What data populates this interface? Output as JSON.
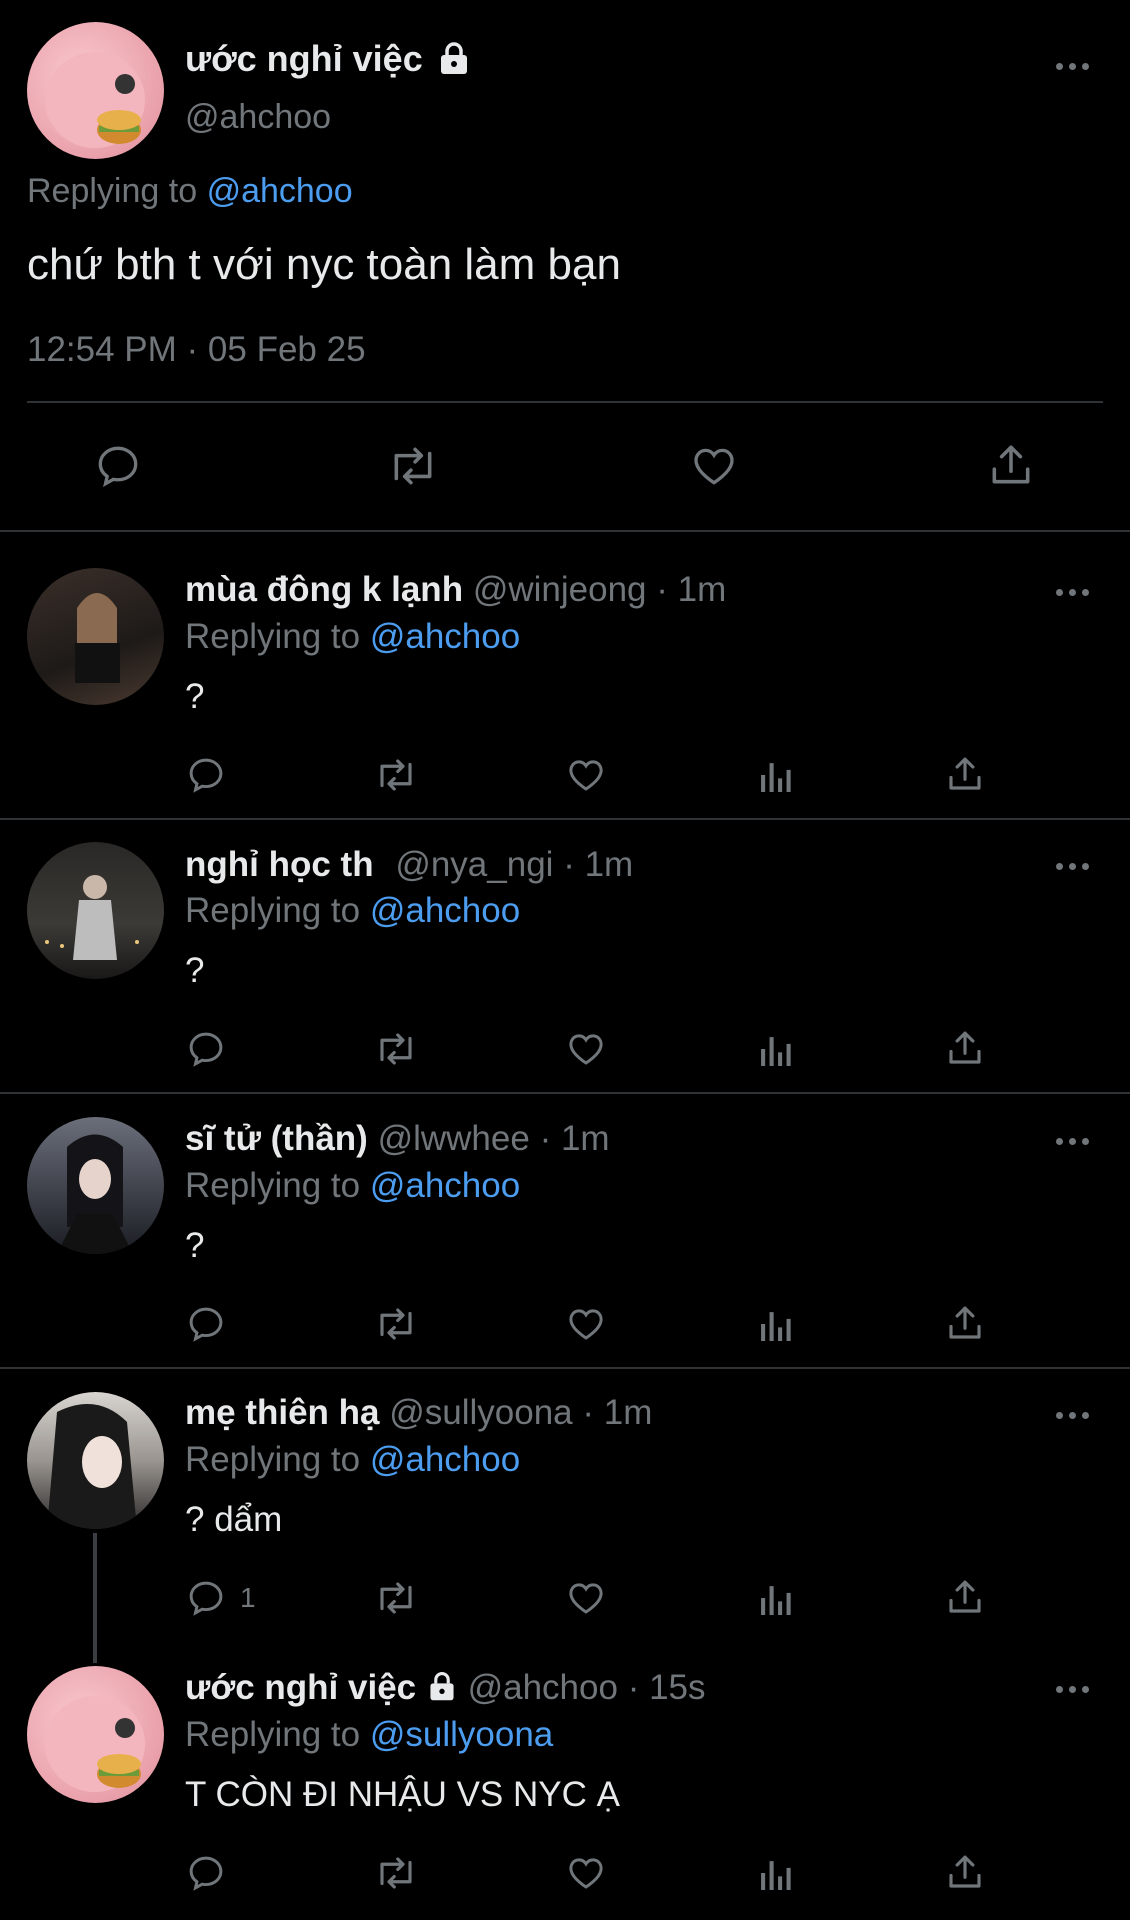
{
  "main_tweet": {
    "display_name": "ước nghỉ việc",
    "handle": "@ahchoo",
    "replying_label": "Replying to",
    "replying_handle": "@ahchoo",
    "text": "chứ bth t với nyc toàn làm bạn",
    "timestamp": "12:54 PM · 05 Feb 25"
  },
  "replies": [
    {
      "display_name": "mùa đông k lạnh",
      "handle": "@winjeong",
      "time": "· 1m",
      "replying_label": "Replying to",
      "replying_handle": "@ahchoo",
      "text": "?",
      "reply_count": ""
    },
    {
      "display_name": "nghỉ học th",
      "handle": "@nya_ngi",
      "time": "· 1m",
      "replying_label": "Replying to",
      "replying_handle": "@ahchoo",
      "text": "?",
      "reply_count": ""
    },
    {
      "display_name": "sĩ tử (thần)",
      "handle": "@lwwhee",
      "time": "· 1m",
      "replying_label": "Replying to",
      "replying_handle": "@ahchoo",
      "text": "?",
      "reply_count": ""
    },
    {
      "display_name": "mẹ thiên hạ",
      "handle": "@sullyoona",
      "time": "· 1m",
      "replying_label": "Replying to",
      "replying_handle": "@ahchoo",
      "text": "? dẩm",
      "reply_count": "1"
    },
    {
      "display_name": "ước nghỉ việc",
      "handle": "@ahchoo",
      "time": "· 15s",
      "replying_label": "Replying to",
      "replying_handle": "@sullyoona",
      "text": "T CÒN ĐI NHẬU VS NYC Ạ",
      "reply_count": ""
    }
  ],
  "colors": {
    "background": "#000000",
    "text": "#e7e9ea",
    "muted": "#71767b",
    "link": "#4c9df0",
    "divider": "#2f3336"
  },
  "icons": [
    "lock-icon",
    "more-icon",
    "reply-icon",
    "retweet-icon",
    "like-icon",
    "share-icon",
    "views-icon"
  ]
}
